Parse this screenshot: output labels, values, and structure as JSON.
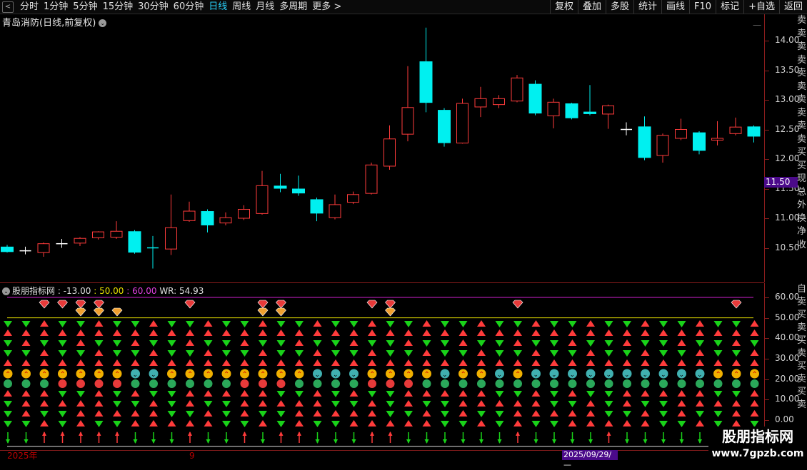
{
  "toolbar": {
    "back_icon": "chevron-left-icon",
    "periods": [
      {
        "label": "分时",
        "active": false
      },
      {
        "label": "1分钟",
        "active": false
      },
      {
        "label": "5分钟",
        "active": false
      },
      {
        "label": "15分钟",
        "active": false
      },
      {
        "label": "30分钟",
        "active": false
      },
      {
        "label": "60分钟",
        "active": false
      },
      {
        "label": "日线",
        "active": true
      },
      {
        "label": "周线",
        "active": false
      },
      {
        "label": "月线",
        "active": false
      },
      {
        "label": "多周期",
        "active": false
      },
      {
        "label": "更多 >",
        "active": false
      }
    ],
    "right_buttons": [
      "复权",
      "叠加",
      "多股",
      "统计",
      "画线",
      "F10",
      "标记",
      "+自选",
      "返回"
    ]
  },
  "stock": {
    "title": "青岛消防(日线,前复权)"
  },
  "colors": {
    "up": "#ff3b3b",
    "down": "#00f0f0",
    "cross": "#ffffff",
    "green_arrow": "#19d219",
    "axis": "#8a1c1c",
    "highlight_bg": "#4b0a8a"
  },
  "price_axis": {
    "ticks": [
      "14.00",
      "13.50",
      "13.00",
      "12.50",
      "12.00",
      "11.50",
      "11.00",
      "10.50"
    ],
    "current_label": "11.50"
  },
  "right_strip_text": "卖卖卖卖卖卖卖卖卖卖买买现总外换净收",
  "chart_data": {
    "type": "candlestick",
    "ylim": [
      10.1,
      14.2
    ],
    "candles": [
      {
        "o": 10.52,
        "c": 10.43,
        "h": 10.55,
        "l": 10.42
      },
      {
        "o": 10.45,
        "c": 10.45,
        "h": 10.52,
        "l": 10.39
      },
      {
        "o": 10.42,
        "c": 10.57,
        "h": 10.59,
        "l": 10.35
      },
      {
        "o": 10.57,
        "c": 10.57,
        "h": 10.65,
        "l": 10.5
      },
      {
        "o": 10.58,
        "c": 10.66,
        "h": 10.68,
        "l": 10.53
      },
      {
        "o": 10.67,
        "c": 10.77,
        "h": 10.78,
        "l": 10.64
      },
      {
        "o": 10.68,
        "c": 10.78,
        "h": 10.95,
        "l": 10.65
      },
      {
        "o": 10.78,
        "c": 10.42,
        "h": 10.8,
        "l": 10.4
      },
      {
        "o": 10.5,
        "c": 10.5,
        "h": 10.7,
        "l": 10.15
      },
      {
        "o": 10.48,
        "c": 10.84,
        "h": 11.4,
        "l": 10.38
      },
      {
        "o": 10.96,
        "c": 11.12,
        "h": 11.28,
        "l": 10.94
      },
      {
        "o": 11.12,
        "c": 10.88,
        "h": 11.15,
        "l": 10.76
      },
      {
        "o": 10.92,
        "c": 11.01,
        "h": 11.1,
        "l": 10.88
      },
      {
        "o": 11.0,
        "c": 11.15,
        "h": 11.22,
        "l": 10.97
      },
      {
        "o": 11.08,
        "c": 11.55,
        "h": 11.8,
        "l": 11.06
      },
      {
        "o": 11.55,
        "c": 11.5,
        "h": 11.75,
        "l": 11.44
      },
      {
        "o": 11.5,
        "c": 11.42,
        "h": 11.72,
        "l": 11.38
      },
      {
        "o": 11.32,
        "c": 11.08,
        "h": 11.35,
        "l": 10.95
      },
      {
        "o": 11.01,
        "c": 11.23,
        "h": 11.4,
        "l": 10.98
      },
      {
        "o": 11.27,
        "c": 11.4,
        "h": 11.45,
        "l": 11.24
      },
      {
        "o": 11.42,
        "c": 11.9,
        "h": 11.94,
        "l": 11.4
      },
      {
        "o": 11.88,
        "c": 12.34,
        "h": 12.57,
        "l": 11.82
      },
      {
        "o": 12.42,
        "c": 12.87,
        "h": 13.57,
        "l": 12.3
      },
      {
        "o": 13.65,
        "c": 12.95,
        "h": 14.22,
        "l": 12.79
      },
      {
        "o": 12.83,
        "c": 12.27,
        "h": 12.86,
        "l": 12.21
      },
      {
        "o": 12.27,
        "c": 12.94,
        "h": 13.02,
        "l": 12.26
      },
      {
        "o": 12.88,
        "c": 13.02,
        "h": 13.22,
        "l": 12.71
      },
      {
        "o": 12.92,
        "c": 13.02,
        "h": 13.08,
        "l": 12.86
      },
      {
        "o": 12.98,
        "c": 13.37,
        "h": 13.42,
        "l": 12.96
      },
      {
        "o": 13.27,
        "c": 12.77,
        "h": 13.33,
        "l": 12.74
      },
      {
        "o": 12.73,
        "c": 12.96,
        "h": 13.02,
        "l": 12.52
      },
      {
        "o": 12.94,
        "c": 12.69,
        "h": 12.95,
        "l": 12.67
      },
      {
        "o": 12.8,
        "c": 12.76,
        "h": 13.25,
        "l": 12.74
      },
      {
        "o": 12.76,
        "c": 12.9,
        "h": 12.92,
        "l": 12.51
      },
      {
        "o": 12.5,
        "c": 12.5,
        "h": 12.62,
        "l": 12.4
      },
      {
        "o": 12.55,
        "c": 12.02,
        "h": 12.72,
        "l": 11.98
      },
      {
        "o": 12.06,
        "c": 12.4,
        "h": 12.43,
        "l": 11.94
      },
      {
        "o": 12.35,
        "c": 12.5,
        "h": 12.68,
        "l": 12.32
      },
      {
        "o": 12.45,
        "c": 12.14,
        "h": 12.47,
        "l": 12.08
      },
      {
        "o": 12.32,
        "c": 12.35,
        "h": 12.64,
        "l": 12.23
      },
      {
        "o": 12.43,
        "c": 12.54,
        "h": 12.7,
        "l": 12.4
      },
      {
        "o": 12.55,
        "c": 12.38,
        "h": 12.57,
        "l": 12.28
      }
    ]
  },
  "indicator": {
    "name": "股朋指标网",
    "value1": ": -13.00",
    "value2": ": 50.00",
    "value3": ": 60.00",
    "wr_label": "WR: 54.93",
    "axis_ticks": [
      "60.00",
      "50.00",
      "40.00",
      "30.00",
      "20.00",
      "10.00",
      "0.00"
    ],
    "right_strip_text": "自卖买卖买卖买卖买卖",
    "levels": [
      60,
      50
    ],
    "diamond1_cols": [
      2,
      3,
      4,
      5,
      10,
      14,
      15,
      20,
      21,
      28,
      40
    ],
    "diamond2_cols": [
      4,
      5,
      6,
      14,
      15,
      21
    ],
    "icon_modes": "YYYYYYYCCYYYYYYYYCCCYYYYCYYCYCCCCCCCCCCYY",
    "bottom_arrows_down": "DDUUUUUDDDUDDUDUUDDDUUDDDDDDUDDDDUDDDDDDU"
  },
  "bottom_axis": {
    "labels": [
      "2025年",
      "9"
    ],
    "date_box": "2025/09/29/—"
  },
  "watermark": {
    "line1": "股朋指标网",
    "line2": "www.7gpzb.com"
  }
}
